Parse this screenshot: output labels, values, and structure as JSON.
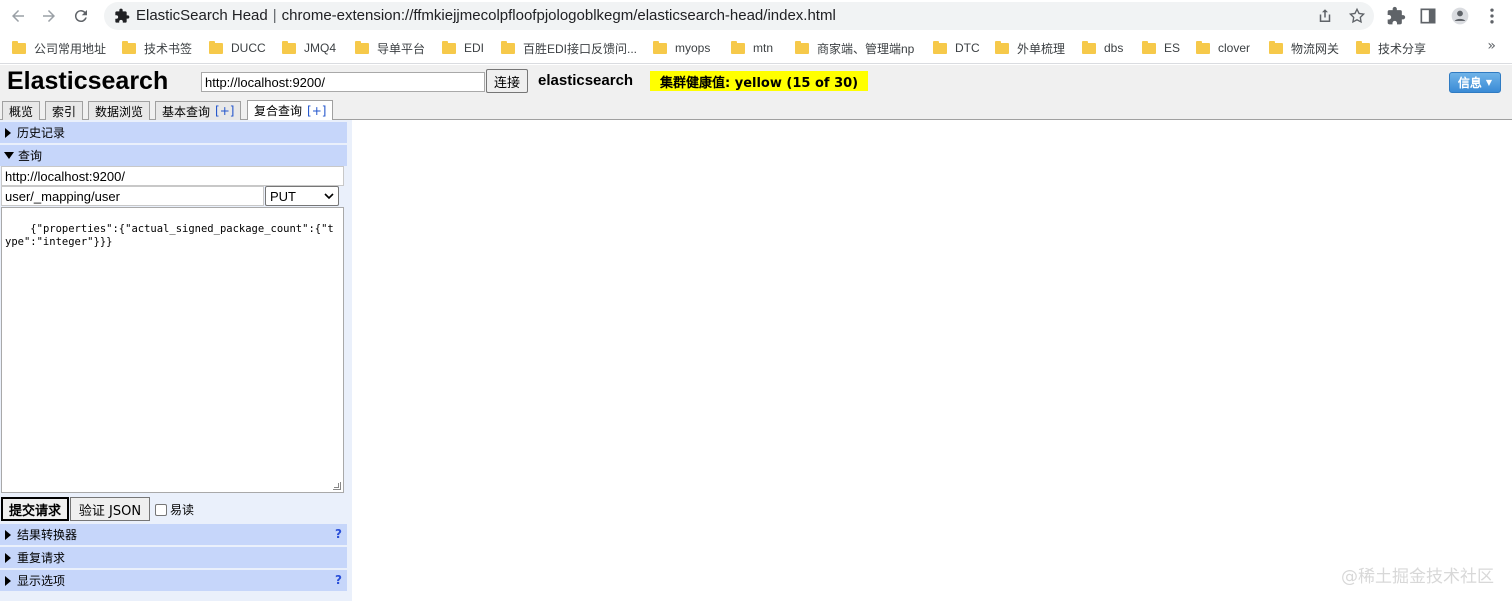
{
  "browser": {
    "tab_title": "ElasticSearch Head",
    "separator": "|",
    "url": "chrome-extension://ffmkiejjmecolpfloofpjologoblkegm/elasticsearch-head/index.html"
  },
  "bookmarks": [
    {
      "label": "公司常用地址"
    },
    {
      "label": "技术书签"
    },
    {
      "label": "DUCC"
    },
    {
      "label": "JMQ4"
    },
    {
      "label": "导单平台"
    },
    {
      "label": "EDI"
    },
    {
      "label": "百胜EDI接口反馈问..."
    },
    {
      "label": "myops"
    },
    {
      "label": "mtn"
    },
    {
      "label": "商家端、管理端np"
    },
    {
      "label": "DTC"
    },
    {
      "label": "外单梳理"
    },
    {
      "label": "dbs"
    },
    {
      "label": "ES"
    },
    {
      "label": "clover"
    },
    {
      "label": "物流网关"
    },
    {
      "label": "技术分享"
    }
  ],
  "bookmarks_more": "»",
  "header": {
    "title": "Elasticsearch",
    "server_url": "http://localhost:9200/",
    "connect_label": "连接",
    "cluster_name": "elasticsearch",
    "health_text": "集群健康值: yellow (15 of 30)",
    "info_label": "信息",
    "info_caret": "▼"
  },
  "tabs": [
    {
      "label": "概览",
      "plus": ""
    },
    {
      "label": "索引",
      "plus": ""
    },
    {
      "label": "数据浏览",
      "plus": ""
    },
    {
      "label": "基本查询",
      "plus": "[+]"
    },
    {
      "label": "复合查询",
      "plus": "[+]"
    }
  ],
  "query_panel": {
    "history_label": "历史记录",
    "query_label": "查询",
    "base_url": "http://localhost:9200/",
    "path": "user/_mapping/user",
    "method": "PUT",
    "method_caret": "⌄",
    "body": "{\"properties\":{\"actual_signed_package_count\":{\"type\":\"integer\"}}}",
    "submit_label": "提交请求",
    "validate_label": "验证 JSON",
    "pretty_label": "易读",
    "transformer_label": "结果转换器",
    "repeat_label": "重复请求",
    "display_options_label": "显示选项",
    "help_mark": "?"
  },
  "watermark": "@稀土掘金技术社区",
  "colors": {
    "health": "#ffff00",
    "section_bg": "#c6d6fa",
    "info_button": "#3a8bd6"
  }
}
